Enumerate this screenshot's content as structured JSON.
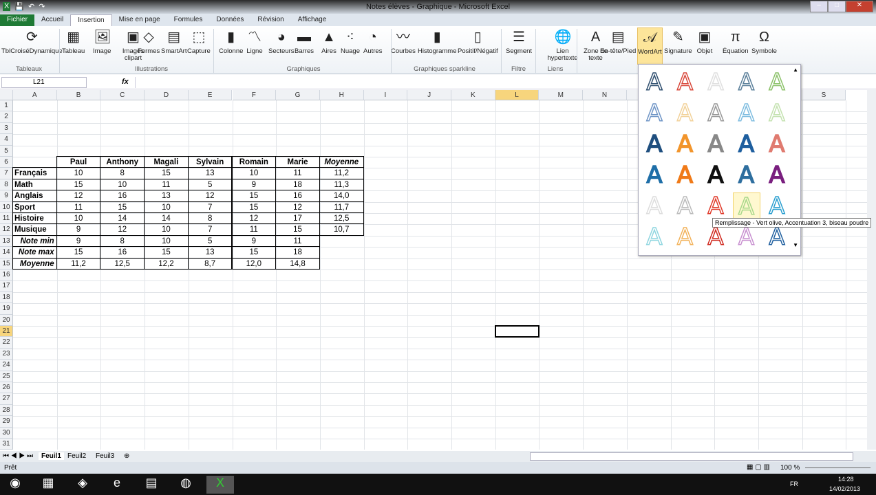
{
  "window": {
    "title": "Notes élèves - Graphique - Microsoft Excel"
  },
  "tabs": [
    "Fichier",
    "Accueil",
    "Insertion",
    "Mise en page",
    "Formules",
    "Données",
    "Révision",
    "Affichage"
  ],
  "active_tab": "Insertion",
  "ribbon": {
    "buttons": [
      {
        "label": "TblCroiséDynamique",
        "icon": "pivot-table-icon"
      },
      {
        "label": "Tableau",
        "icon": "table-icon"
      },
      {
        "label": "Image",
        "icon": "image-icon"
      },
      {
        "label": "Images clipart",
        "icon": "clipart-icon"
      },
      {
        "label": "Formes",
        "icon": "shapes-icon"
      },
      {
        "label": "SmartArt",
        "icon": "smartart-icon"
      },
      {
        "label": "Capture",
        "icon": "screenshot-icon"
      },
      {
        "label": "Colonne",
        "icon": "column-chart-icon"
      },
      {
        "label": "Ligne",
        "icon": "line-chart-icon"
      },
      {
        "label": "Secteurs",
        "icon": "pie-chart-icon"
      },
      {
        "label": "Barres",
        "icon": "bar-chart-icon"
      },
      {
        "label": "Aires",
        "icon": "area-chart-icon"
      },
      {
        "label": "Nuage",
        "icon": "scatter-chart-icon"
      },
      {
        "label": "Autres",
        "icon": "other-charts-icon"
      },
      {
        "label": "Courbes",
        "icon": "sparkline-line-icon"
      },
      {
        "label": "Histogramme",
        "icon": "sparkline-column-icon"
      },
      {
        "label": "Positif/Négatif",
        "icon": "sparkline-winloss-icon"
      },
      {
        "label": "Segment",
        "icon": "slicer-icon"
      },
      {
        "label": "Lien hypertexte",
        "icon": "hyperlink-icon"
      },
      {
        "label": "Zone de texte",
        "icon": "textbox-icon"
      },
      {
        "label": "En-tête/Pied",
        "icon": "header-footer-icon"
      },
      {
        "label": "WordArt",
        "icon": "wordart-icon"
      },
      {
        "label": "Signature",
        "icon": "signature-icon"
      },
      {
        "label": "Objet",
        "icon": "object-icon"
      },
      {
        "label": "Équation",
        "icon": "equation-icon"
      },
      {
        "label": "Symbole",
        "icon": "symbol-icon"
      }
    ],
    "groups": [
      "Tableaux",
      "Illustrations",
      "Graphiques",
      "Graphiques sparkline",
      "Filtre",
      "Liens"
    ]
  },
  "formula_bar": {
    "name_box": "L21",
    "fx": "fx",
    "formula": ""
  },
  "columns": [
    "A",
    "B",
    "C",
    "D",
    "E",
    "F",
    "G",
    "H",
    "I",
    "J",
    "K",
    "L",
    "M",
    "N",
    "O",
    "P",
    "Q",
    "R",
    "S"
  ],
  "selected_cell": {
    "col": "L",
    "row": 21
  },
  "table": {
    "header": [
      "",
      "Paul",
      "Anthony",
      "Magali",
      "Sylvain",
      "Romain",
      "Marie",
      "Moyenne"
    ],
    "rows": [
      [
        "Français",
        "10",
        "8",
        "15",
        "13",
        "10",
        "11",
        "11,2"
      ],
      [
        "Math",
        "15",
        "10",
        "11",
        "5",
        "9",
        "18",
        "11,3"
      ],
      [
        "Anglais",
        "12",
        "16",
        "13",
        "12",
        "15",
        "16",
        "14,0"
      ],
      [
        "Sport",
        "11",
        "15",
        "10",
        "7",
        "15",
        "12",
        "11,7"
      ],
      [
        "Histoire",
        "10",
        "14",
        "14",
        "8",
        "12",
        "17",
        "12,5"
      ],
      [
        "Musique",
        "9",
        "12",
        "10",
        "7",
        "11",
        "15",
        "10,7"
      ],
      [
        "Note min",
        "9",
        "8",
        "10",
        "5",
        "9",
        "11"
      ],
      [
        "Note max",
        "15",
        "16",
        "15",
        "13",
        "15",
        "18"
      ],
      [
        "Moyenne",
        "11,2",
        "12,5",
        "12,2",
        "8,7",
        "12,0",
        "14,8"
      ]
    ]
  },
  "wordart_gallery": {
    "glyph": "A",
    "colors": [
      "#2f4f6f",
      "#d9483b",
      "#e0e0e0",
      "#5a7f9a",
      "#8cc26a",
      "#6f95c6",
      "#f2d29a",
      "#999",
      "#7fbde0",
      "#c4e2b0",
      "#1f4f7f",
      "#f2952c",
      "#888",
      "#1f5f9f",
      "#e07b70",
      "#1f6fa8",
      "#f07a18",
      "#111",
      "#2f6f9f",
      "#7a1f7f",
      "#ddd",
      "#bbb",
      "#e03a2a",
      "#a8d88a",
      "#2a9fd0",
      "#8fd6e0",
      "#f2b25a",
      "#d0281e",
      "#c890d0",
      "#1f5f9f"
    ],
    "hovered_index": 23,
    "tooltip": "Remplissage - Vert olive, Accentuation 3, biseau poudre"
  },
  "sheets": [
    "Feuil1",
    "Feuil2",
    "Feuil3"
  ],
  "active_sheet": "Feuil1",
  "status": {
    "text": "Prêt",
    "zoom": "100 %"
  },
  "taskbar": {
    "lang": "FR",
    "time": "14:28",
    "date": "14/02/2013",
    "apps": [
      "start-icon",
      "calculator-icon",
      "notes-icon",
      "ie-icon",
      "explorer-icon",
      "firefox-icon",
      "excel-icon"
    ]
  }
}
